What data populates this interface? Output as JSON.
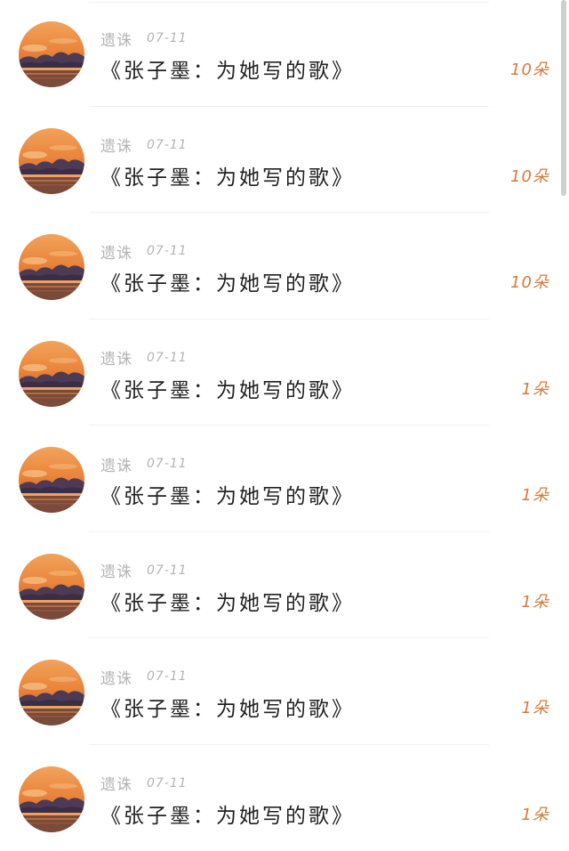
{
  "items": [
    {
      "author": "遗诛",
      "date": "07-11",
      "title": "《张子墨：为她写的歌》",
      "count": "10朵"
    },
    {
      "author": "遗诛",
      "date": "07-11",
      "title": "《张子墨：为她写的歌》",
      "count": "10朵"
    },
    {
      "author": "遗诛",
      "date": "07-11",
      "title": "《张子墨：为她写的歌》",
      "count": "10朵"
    },
    {
      "author": "遗诛",
      "date": "07-11",
      "title": "《张子墨：为她写的歌》",
      "count": "1朵"
    },
    {
      "author": "遗诛",
      "date": "07-11",
      "title": "《张子墨：为她写的歌》",
      "count": "1朵"
    },
    {
      "author": "遗诛",
      "date": "07-11",
      "title": "《张子墨：为她写的歌》",
      "count": "1朵"
    },
    {
      "author": "遗诛",
      "date": "07-11",
      "title": "《张子墨：为她写的歌》",
      "count": "1朵"
    },
    {
      "author": "遗诛",
      "date": "07-11",
      "title": "《张子墨：为她写的歌》",
      "count": "1朵"
    }
  ],
  "colors": {
    "count": "#d67a3a",
    "meta": "#b4b4b4",
    "title": "#222222"
  },
  "avatar_icon": "sunset-avatar-icon"
}
